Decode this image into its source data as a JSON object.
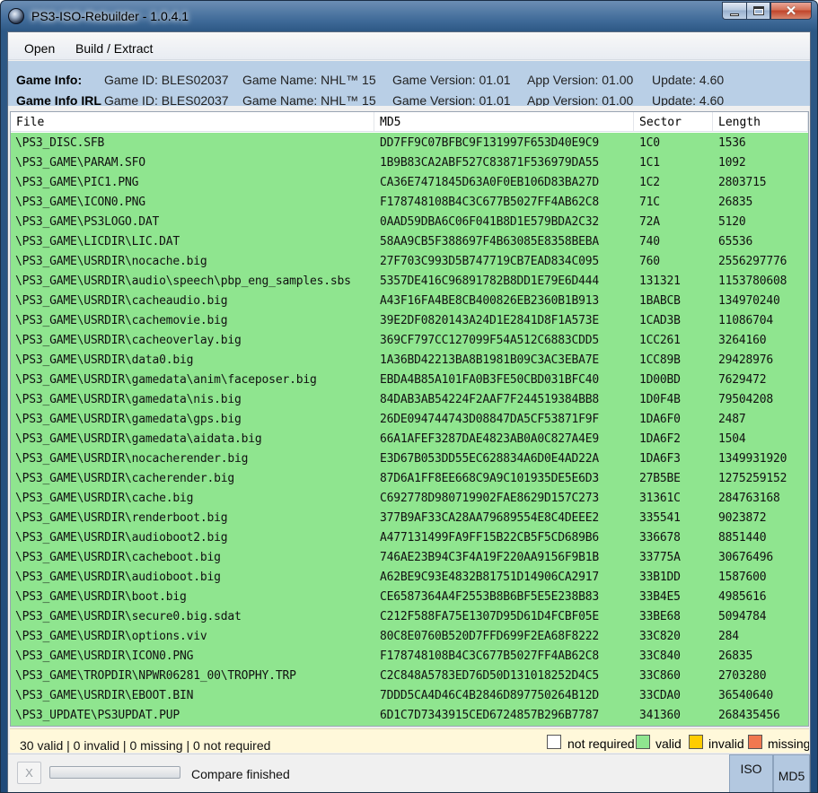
{
  "window": {
    "title": "PS3-ISO-Rebuilder - 1.0.4.1"
  },
  "menu": {
    "open": "Open",
    "build_extract": "Build / Extract"
  },
  "game_info": {
    "label": "Game Info:",
    "label_irl": "Game Info IRL",
    "game_id": "Game ID: BLES02037",
    "game_name": "Game Name: NHL™ 15",
    "game_version": "Game Version: 01.01",
    "app_version": "App Version: 01.00",
    "update": "Update: 4.60"
  },
  "table": {
    "headers": {
      "file": "File",
      "md5": "MD5",
      "sector": "Sector",
      "length": "Length"
    },
    "row_color": "#8fe58f",
    "rows": [
      {
        "file": "\\PS3_DISC.SFB",
        "md5": "DD7FF9C07BFBC9F131997F653D40E9C9",
        "sector": "1C0",
        "length": "1536"
      },
      {
        "file": "\\PS3_GAME\\PARAM.SFO",
        "md5": "1B9B83CA2ABF527C83871F536979DA55",
        "sector": "1C1",
        "length": "1092"
      },
      {
        "file": "\\PS3_GAME\\PIC1.PNG",
        "md5": "CA36E7471845D63A0F0EB106D83BA27D",
        "sector": "1C2",
        "length": "2803715"
      },
      {
        "file": "\\PS3_GAME\\ICON0.PNG",
        "md5": "F178748108B4C3C677B5027FF4AB62C8",
        "sector": "71C",
        "length": "26835"
      },
      {
        "file": "\\PS3_GAME\\PS3LOGO.DAT",
        "md5": "0AAD59DBA6C06F041B8D1E579BDA2C32",
        "sector": "72A",
        "length": "5120"
      },
      {
        "file": "\\PS3_GAME\\LICDIR\\LIC.DAT",
        "md5": "58AA9CB5F388697F4B63085E8358BEBA",
        "sector": "740",
        "length": "65536"
      },
      {
        "file": "\\PS3_GAME\\USRDIR\\nocache.big",
        "md5": "27F703C993D5B747719CB7EAD834C095",
        "sector": "760",
        "length": "2556297776"
      },
      {
        "file": "\\PS3_GAME\\USRDIR\\audio\\speech\\pbp_eng_samples.sbs",
        "md5": "5357DE416C96891782B8DD1E79E6D444",
        "sector": "131321",
        "length": "1153780608"
      },
      {
        "file": "\\PS3_GAME\\USRDIR\\cacheaudio.big",
        "md5": "A43F16FA4BE8CB400826EB2360B1B913",
        "sector": "1BABCB",
        "length": "134970240"
      },
      {
        "file": "\\PS3_GAME\\USRDIR\\cachemovie.big",
        "md5": "39E2DF0820143A24D1E2841D8F1A573E",
        "sector": "1CAD3B",
        "length": "11086704"
      },
      {
        "file": "\\PS3_GAME\\USRDIR\\cacheoverlay.big",
        "md5": "369CF797CC127099F54A512C6883CDD5",
        "sector": "1CC261",
        "length": "3264160"
      },
      {
        "file": "\\PS3_GAME\\USRDIR\\data0.big",
        "md5": "1A36BD42213BA8B1981B09C3AC3EBA7E",
        "sector": "1CC89B",
        "length": "29428976"
      },
      {
        "file": "\\PS3_GAME\\USRDIR\\gamedata\\anim\\faceposer.big",
        "md5": "EBDA4B85A101FA0B3FE50CBD031BFC40",
        "sector": "1D00BD",
        "length": "7629472"
      },
      {
        "file": "\\PS3_GAME\\USRDIR\\gamedata\\nis.big",
        "md5": "84DAB3AB54224F2AAF7F244519384BB8",
        "sector": "1D0F4B",
        "length": "79504208"
      },
      {
        "file": "\\PS3_GAME\\USRDIR\\gamedata\\gps.big",
        "md5": "26DE094744743D08847DA5CF53871F9F",
        "sector": "1DA6F0",
        "length": "2487"
      },
      {
        "file": "\\PS3_GAME\\USRDIR\\gamedata\\aidata.big",
        "md5": "66A1AFEF3287DAE4823AB0A0C827A4E9",
        "sector": "1DA6F2",
        "length": "1504"
      },
      {
        "file": "\\PS3_GAME\\USRDIR\\nocacherender.big",
        "md5": "E3D67B053DD55EC628834A6D0E4AD22A",
        "sector": "1DA6F3",
        "length": "1349931920"
      },
      {
        "file": "\\PS3_GAME\\USRDIR\\cacherender.big",
        "md5": "87D6A1FF8EE668C9A9C101935DE5E6D3",
        "sector": "27B5BE",
        "length": "1275259152"
      },
      {
        "file": "\\PS3_GAME\\USRDIR\\cache.big",
        "md5": "C692778D980719902FAE8629D157C273",
        "sector": "31361C",
        "length": "284763168"
      },
      {
        "file": "\\PS3_GAME\\USRDIR\\renderboot.big",
        "md5": "377B9AF33CA28AA79689554E8C4DEEE2",
        "sector": "335541",
        "length": "9023872"
      },
      {
        "file": "\\PS3_GAME\\USRDIR\\audioboot2.big",
        "md5": "A477131499FA9FF15B22CB5F5CD689B6",
        "sector": "336678",
        "length": "8851440"
      },
      {
        "file": "\\PS3_GAME\\USRDIR\\cacheboot.big",
        "md5": "746AE23B94C3F4A19F220AA9156F9B1B",
        "sector": "33775A",
        "length": "30676496"
      },
      {
        "file": "\\PS3_GAME\\USRDIR\\audioboot.big",
        "md5": "A62BE9C93E4832B81751D14906CA2917",
        "sector": "33B1DD",
        "length": "1587600"
      },
      {
        "file": "\\PS3_GAME\\USRDIR\\boot.big",
        "md5": "CE6587364A4F2553B8B6BF5E5E238B83",
        "sector": "33B4E5",
        "length": "4985616"
      },
      {
        "file": "\\PS3_GAME\\USRDIR\\secure0.big.sdat",
        "md5": "C212F588FA75E1307D95D61D4FCBF05E",
        "sector": "33BE68",
        "length": "5094784"
      },
      {
        "file": "\\PS3_GAME\\USRDIR\\options.viv",
        "md5": "80C8E0760B520D7FFD699F2EA68F8222",
        "sector": "33C820",
        "length": "284"
      },
      {
        "file": "\\PS3_GAME\\USRDIR\\ICON0.PNG",
        "md5": "F178748108B4C3C677B5027FF4AB62C8",
        "sector": "33C840",
        "length": "26835"
      },
      {
        "file": "\\PS3_GAME\\TROPDIR\\NPWR06281_00\\TROPHY.TRP",
        "md5": "C2C848A5783ED76D50D131018252D4C5",
        "sector": "33C860",
        "length": "2703280"
      },
      {
        "file": "\\PS3_GAME\\USRDIR\\EBOOT.BIN",
        "md5": "7DDD5CA4D46C4B2846D897750264B12D",
        "sector": "33CDA0",
        "length": "36540640"
      },
      {
        "file": "\\PS3_UPDATE\\PS3UPDAT.PUP",
        "md5": "6D1C7D7343915CED6724857B296B7787",
        "sector": "341360",
        "length": "268435456"
      }
    ]
  },
  "summary": {
    "text": "30 valid | 0 invalid | 0 missing | 0 not required",
    "legend": {
      "not_required": "not required",
      "valid": "valid",
      "invalid": "invalid",
      "missing": "missing"
    },
    "colors": {
      "not_required": "#ffffff",
      "valid": "#8fe58f",
      "invalid": "#ffcc00",
      "missing": "#f07850"
    }
  },
  "status": {
    "cancel_label": "X",
    "message": "Compare finished",
    "progress_percent": 0,
    "iso_label": "ISO",
    "md5_label": "MD5"
  }
}
